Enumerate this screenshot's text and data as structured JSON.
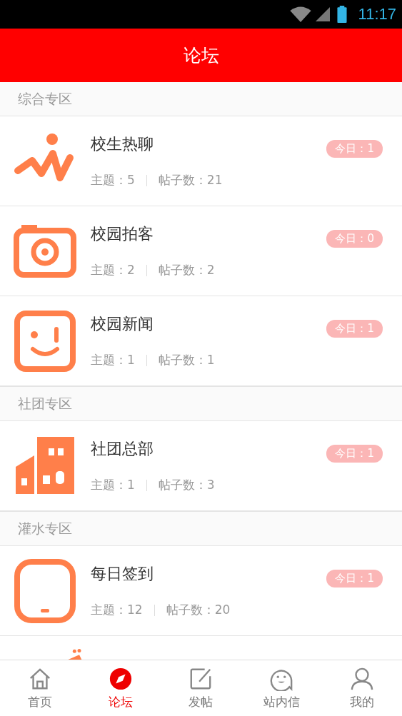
{
  "status_bar": {
    "time": "11:17"
  },
  "header": {
    "title": "论坛"
  },
  "sections": [
    {
      "title": "综合专区",
      "forums": [
        {
          "kind": "wave",
          "name": "校生热聊",
          "topics": "主题：5",
          "posts": "帖子数：21",
          "today": "今日：1"
        },
        {
          "kind": "camera",
          "name": "校园拍客",
          "topics": "主题：2",
          "posts": "帖子数：2",
          "today": "今日：0"
        },
        {
          "kind": "smile",
          "name": "校园新闻",
          "topics": "主题：1",
          "posts": "帖子数：1",
          "today": "今日：1"
        }
      ]
    },
    {
      "title": "社团专区",
      "forums": [
        {
          "kind": "building",
          "name": "社团总部",
          "topics": "主题：1",
          "posts": "帖子数：3",
          "today": "今日：1"
        }
      ]
    },
    {
      "title": "灌水专区",
      "forums": [
        {
          "kind": "pad",
          "name": "每日签到",
          "topics": "主题：12",
          "posts": "帖子数：20",
          "today": "今日：1"
        }
      ]
    }
  ],
  "tabs": [
    {
      "kind": "home",
      "label": "首页",
      "selected": false
    },
    {
      "kind": "compass",
      "label": "论坛",
      "selected": true
    },
    {
      "kind": "edit",
      "label": "发帖",
      "selected": false
    },
    {
      "kind": "chat",
      "label": "站内信",
      "selected": false
    },
    {
      "kind": "user",
      "label": "我的",
      "selected": false
    }
  ]
}
